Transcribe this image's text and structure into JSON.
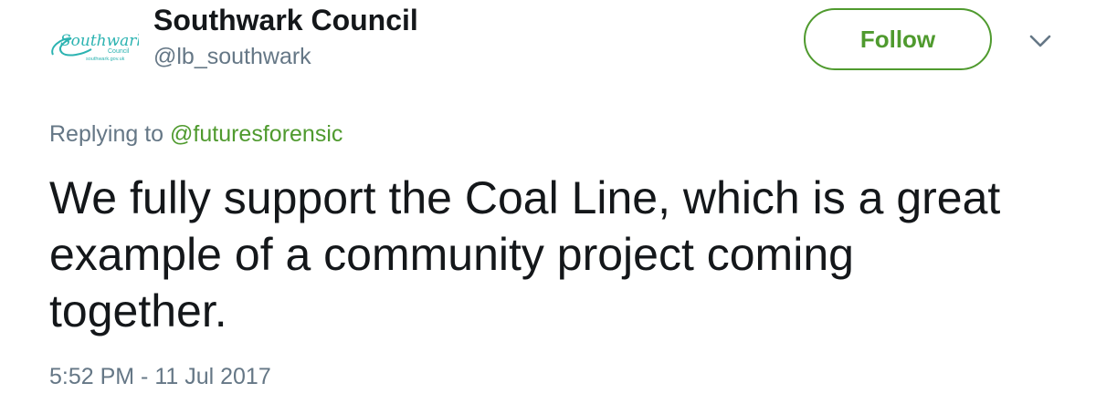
{
  "author": {
    "name": "Southwark Council",
    "handle": "@lb_southwark",
    "logo": {
      "wordmark": "Southwark",
      "subtitle": "Council",
      "url_text": "southwark.gov.uk",
      "color": "#2bb3b1"
    }
  },
  "follow_button": {
    "label": "Follow",
    "color": "#4f9a2e"
  },
  "menu": {
    "icon": "chevron-down-icon"
  },
  "reply_context": {
    "prefix": "Replying to",
    "mention": "@futuresforensic"
  },
  "tweet": {
    "text": "We fully support the Coal Line, which is a great example of a community project coming together.",
    "timestamp": "5:52 PM - 11 Jul 2017"
  }
}
